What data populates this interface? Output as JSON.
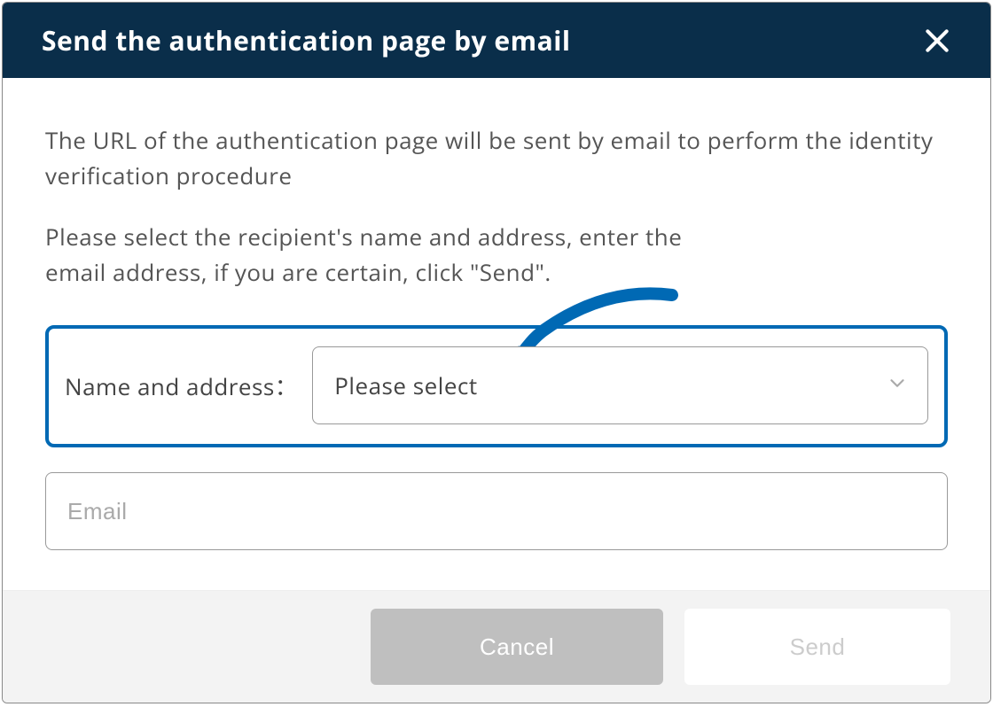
{
  "modal": {
    "title": "Send the authentication page by email",
    "description": "The URL of the authentication page will be sent by email to perform the identity verification procedure",
    "instruction": "Please select the recipient's name and address, enter the email address, if you are certain, click \"Send\".",
    "field_label": "Name and address：",
    "select_placeholder": "Please select",
    "email_placeholder": "Email",
    "email_value": "",
    "cancel_label": "Cancel",
    "send_label": "Send"
  },
  "colors": {
    "header_bg": "#0a2e4a",
    "highlight_border": "#0069b4",
    "cancel_bg": "#bfbfbf"
  }
}
